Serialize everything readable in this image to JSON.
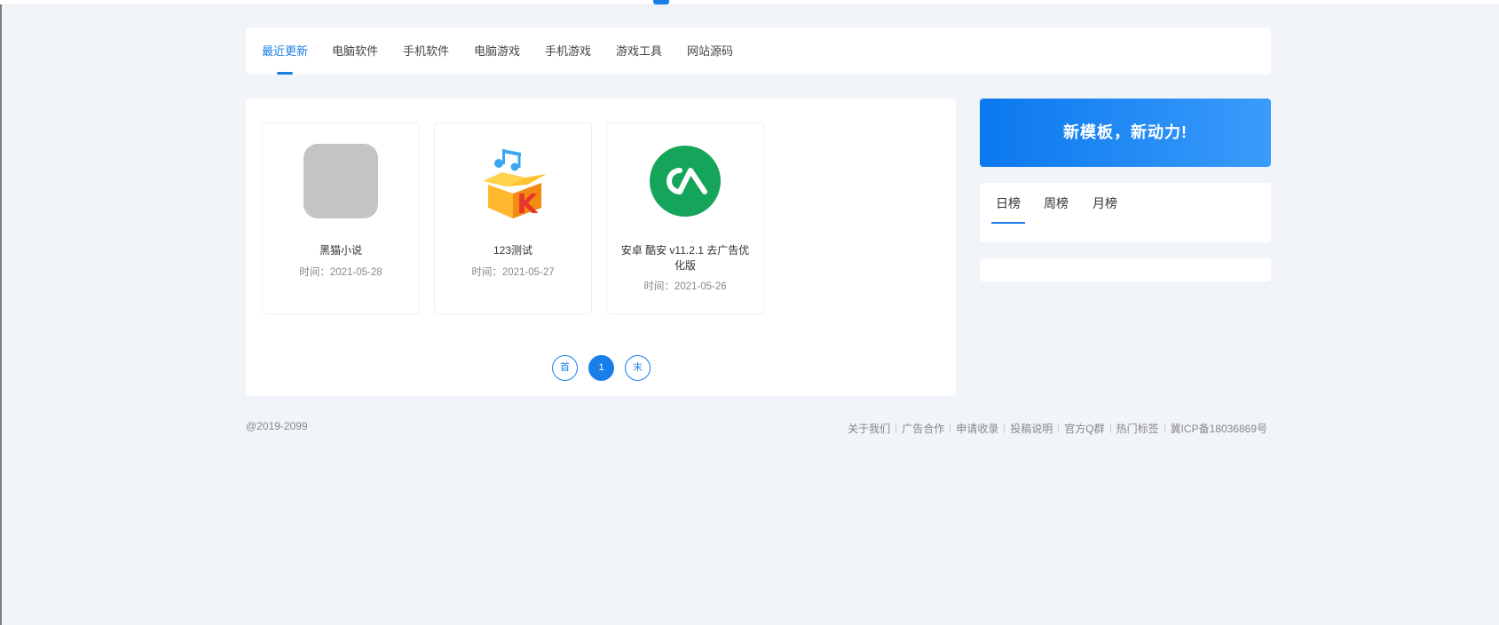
{
  "nav": {
    "tabs": [
      {
        "label": "最近更新",
        "active": true
      },
      {
        "label": "电脑软件"
      },
      {
        "label": "手机软件"
      },
      {
        "label": "电脑游戏"
      },
      {
        "label": "手机游戏"
      },
      {
        "label": "游戏工具"
      },
      {
        "label": "网站源码"
      }
    ]
  },
  "cards": [
    {
      "title": "黑猫小说",
      "time": "时间：2021-05-28",
      "icon": "placeholder-app-icon"
    },
    {
      "title": "123测试",
      "time": "时间：2021-05-27",
      "icon": "music-box-k-icon"
    },
    {
      "title": "安卓 酷安 v11.2.1 去广告优化版",
      "time": "时间：2021-05-26",
      "icon": "coolapk-logo-icon"
    }
  ],
  "pagination": {
    "first": "首",
    "current": "1",
    "last": "末"
  },
  "banner": {
    "text": "新模板，新动力!"
  },
  "ranking": {
    "tabs": [
      {
        "label": "日榜",
        "active": true
      },
      {
        "label": "周榜"
      },
      {
        "label": "月榜"
      }
    ]
  },
  "footer": {
    "copyright": "@2019-2099",
    "links": [
      "关于我们",
      "广告合作",
      "申请收录",
      "投稿说明",
      "官方Q群",
      "热门标签",
      "冀ICP备18036869号"
    ]
  },
  "colors": {
    "accent": "#1a7ee8",
    "page_background": "#f1f4f8",
    "banner_gradient_start": "#0a78ef",
    "banner_gradient_end": "#3a9cfb",
    "coolapk_green": "#14a55a"
  }
}
